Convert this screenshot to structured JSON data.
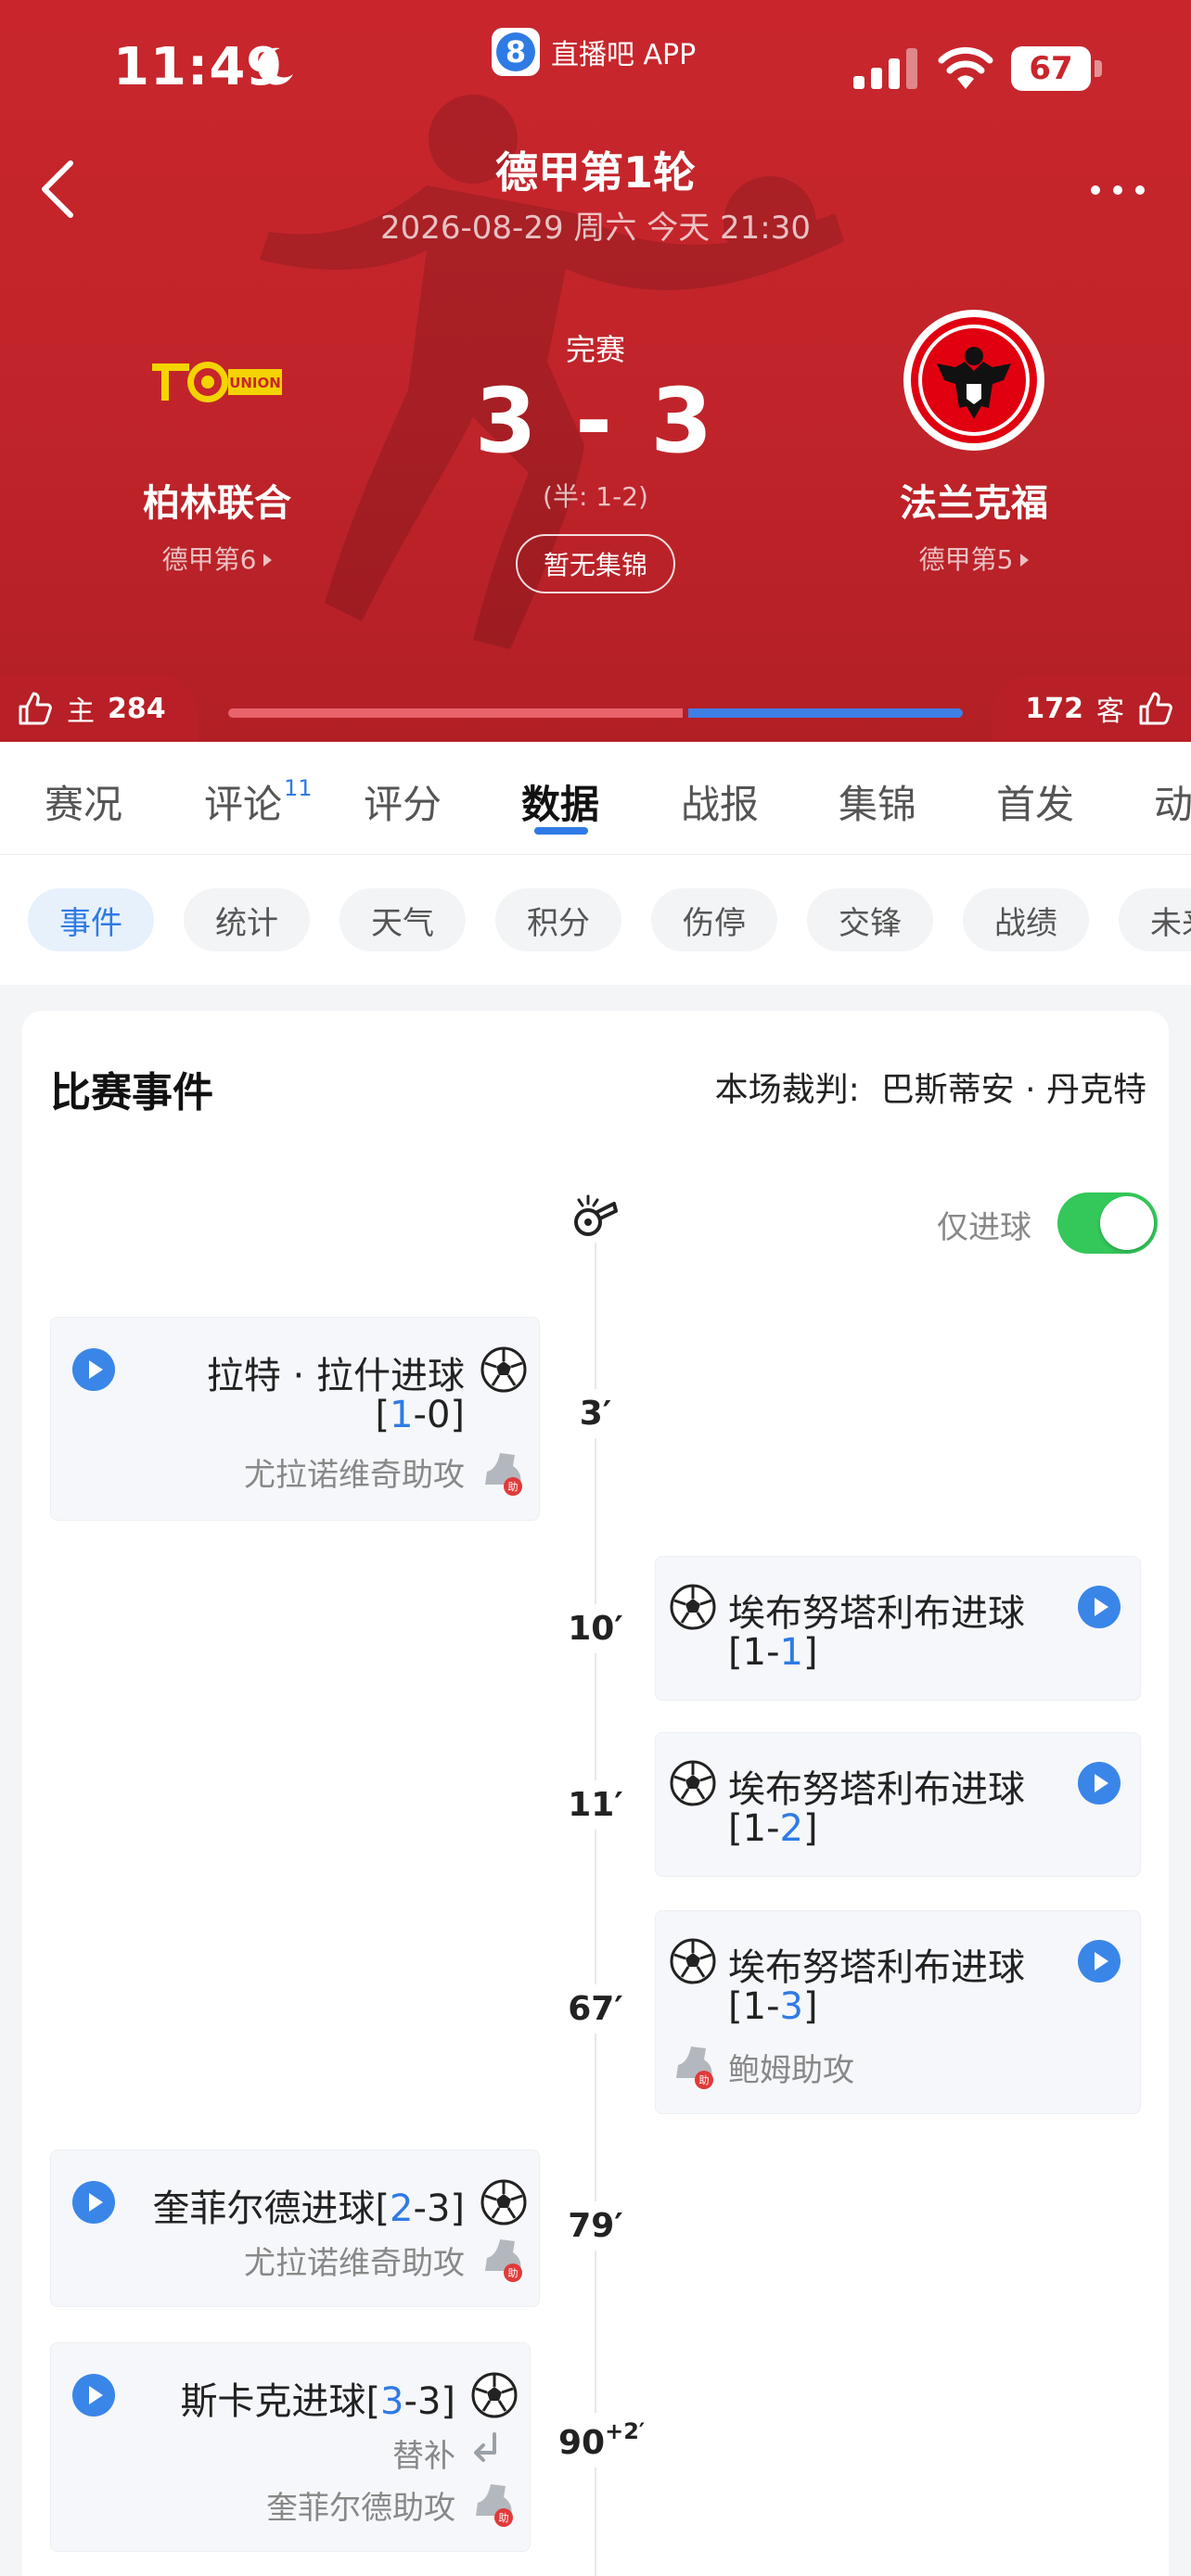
{
  "status_bar": {
    "time": "11:49",
    "app_name": "直播吧 APP",
    "app_badge": "8",
    "battery": "67"
  },
  "header": {
    "league": "德甲第1轮",
    "date": "2026-08-29 周六 今天 21:30",
    "status": "完赛",
    "score": "3 - 3",
    "halftime": "(半: 1-2)",
    "highlights": "暂无集锦",
    "home": {
      "name": "柏林联合",
      "rank": "德甲第6"
    },
    "away": {
      "name": "法兰克福",
      "rank": "德甲第5"
    }
  },
  "votes": {
    "home_label": "主",
    "home_count": "284",
    "away_label": "客",
    "away_count": "172",
    "home_share": 0.623
  },
  "tabs": [
    {
      "label": "赛况"
    },
    {
      "label": "评论",
      "badge": "11"
    },
    {
      "label": "评分"
    },
    {
      "label": "数据"
    },
    {
      "label": "战报"
    },
    {
      "label": "集锦"
    },
    {
      "label": "首发"
    },
    {
      "label": "动"
    }
  ],
  "chips": [
    "事件",
    "统计",
    "天气",
    "积分",
    "伤停",
    "交锋",
    "战绩",
    "未来"
  ],
  "events_card": {
    "title": "比赛事件",
    "referee_label": "本场裁判:",
    "referee": "巴斯蒂安 · 丹克特",
    "goals_only": "仅进球",
    "goals_only_on": true
  },
  "events": [
    {
      "minute": "3′",
      "title": "拉特 · 拉什进球",
      "score_l": "1",
      "score_r": "0",
      "assist": "尤拉诺维奇助攻"
    },
    {
      "minute": "10′",
      "title": "埃布努塔利布进球",
      "score_l": "1",
      "score_r": "1"
    },
    {
      "minute": "11′",
      "title": "埃布努塔利布进球",
      "score_l": "1",
      "score_r": "2"
    },
    {
      "minute": "67′",
      "title": "埃布努塔利布进球",
      "score_l": "1",
      "score_r": "3",
      "assist": "鲍姆助攻"
    },
    {
      "minute": "79′",
      "title": "奎菲尔德进球",
      "score_l": "2",
      "score_r": "3",
      "assist": "尤拉诺维奇助攻"
    },
    {
      "minute": "90",
      "minute_extra": "+2′",
      "title": "斯卡克进球",
      "score_l": "3",
      "score_r": "3",
      "note": "替补",
      "assist": "奎菲尔德助攻"
    }
  ],
  "colors": {
    "header_red": "#c8262c",
    "accent_blue": "#2f7be5",
    "toggle_green": "#34c759"
  }
}
